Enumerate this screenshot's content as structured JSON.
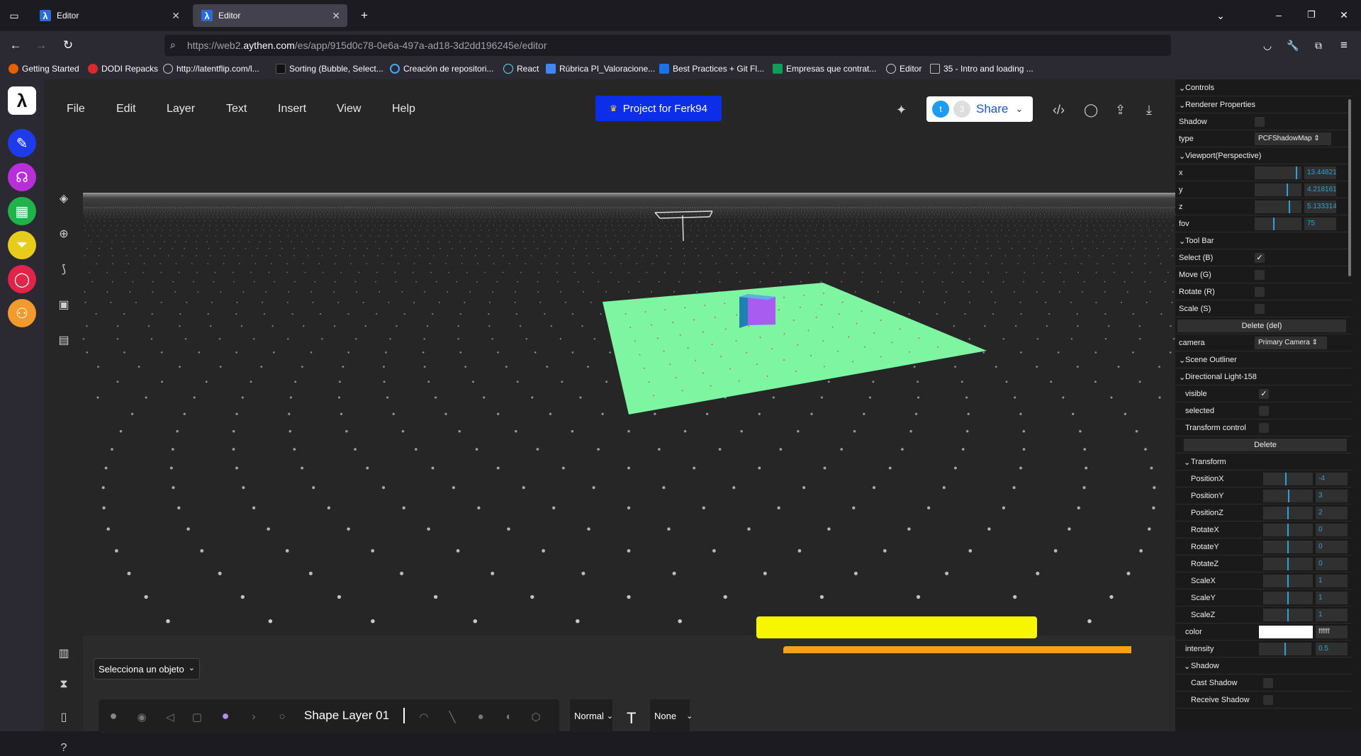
{
  "browser": {
    "tabs": [
      {
        "label": "Editor",
        "active": false
      },
      {
        "label": "Editor",
        "active": true
      }
    ],
    "url_prefix": "https://web2.",
    "url_host": "aythen.com",
    "url_path": "/es/app/915d0c78-0e6a-497a-ad18-3d2dd196245e/editor",
    "bookmarks": [
      {
        "label": "Getting Started",
        "color": "#e66000"
      },
      {
        "label": "DODI Repacks",
        "color": "#d92b2b"
      },
      {
        "label": "http://latentflip.com/l...",
        "color": "#888888"
      },
      {
        "label": "Sorting (Bubble, Select...",
        "color": "#333333"
      },
      {
        "label": "Creación de repositori...",
        "color": "#4aa3ff"
      },
      {
        "label": "React",
        "color": "#61dafb"
      },
      {
        "label": "Rúbrica PI_Valoracione...",
        "color": "#4285f4"
      },
      {
        "label": "Best Practices + Git Fl...",
        "color": "#1d72e8"
      },
      {
        "label": "Empresas que contrat...",
        "color": "#0f9d58"
      },
      {
        "label": "Editor",
        "color": "#888888"
      },
      {
        "label": "35 - Intro and loading ...",
        "color": "#bbbbbb"
      }
    ]
  },
  "menu": {
    "items": [
      "File",
      "Edit",
      "Layer",
      "Text",
      "Insert",
      "View",
      "Help"
    ],
    "project_button": "Project for Ferk94",
    "share_label": "Share",
    "share_count": "3"
  },
  "bottom": {
    "select_object": "Selecciona un objeto",
    "layer_name": "Shape Layer 01",
    "blend_mode": "Normal",
    "text_mode": "None"
  },
  "panel": {
    "controls": "Controls",
    "renderer": "Renderer Properties",
    "shadow": "Shadow",
    "type_label": "type",
    "type_value": "PCFShadowMap",
    "viewport": "Viewport(Perspective)",
    "vp": [
      {
        "label": "x",
        "value": "13.44821",
        "level": 0.9
      },
      {
        "label": "y",
        "value": "4.218161",
        "level": 0.7
      },
      {
        "label": "z",
        "value": "5.133314",
        "level": 0.75
      },
      {
        "label": "fov",
        "value": "75",
        "level": 0.4
      }
    ],
    "toolbar": "Tool Bar",
    "tools": [
      {
        "label": "Select (B)",
        "checked": true
      },
      {
        "label": "Move (G)",
        "checked": false
      },
      {
        "label": "Rotate (R)",
        "checked": false
      },
      {
        "label": "Scale (S)",
        "checked": false
      }
    ],
    "delete_del": "Delete (del)",
    "camera_label": "camera",
    "camera_value": "Primary Camera",
    "scene_outliner": "Scene Outliner",
    "light_name": "Directional Light-158",
    "visible": "visible",
    "selected": "selected",
    "transform_control": "Transform control",
    "delete": "Delete",
    "transform": "Transform",
    "props": [
      {
        "label": "PositionX",
        "value": "-4",
        "level": 0.45
      },
      {
        "label": "PositionY",
        "value": "3",
        "level": 0.52
      },
      {
        "label": "PositionZ",
        "value": "2",
        "level": 0.5
      },
      {
        "label": "RotateX",
        "value": "0",
        "level": 0.5
      },
      {
        "label": "RotateY",
        "value": "0",
        "level": 0.5
      },
      {
        "label": "RotateZ",
        "value": "0",
        "level": 0.5
      },
      {
        "label": "ScaleX",
        "value": "1",
        "level": 0.5
      },
      {
        "label": "ScaleY",
        "value": "1",
        "level": 0.5
      },
      {
        "label": "ScaleZ",
        "value": "1",
        "level": 0.5
      }
    ],
    "color_label": "color",
    "color_value": "ffffff",
    "intensity_label": "intensity",
    "intensity_value": "0.5",
    "shadow_section": "Shadow",
    "cast_shadow": "Cast Shadow",
    "receive_shadow": "Receive Shadow"
  }
}
